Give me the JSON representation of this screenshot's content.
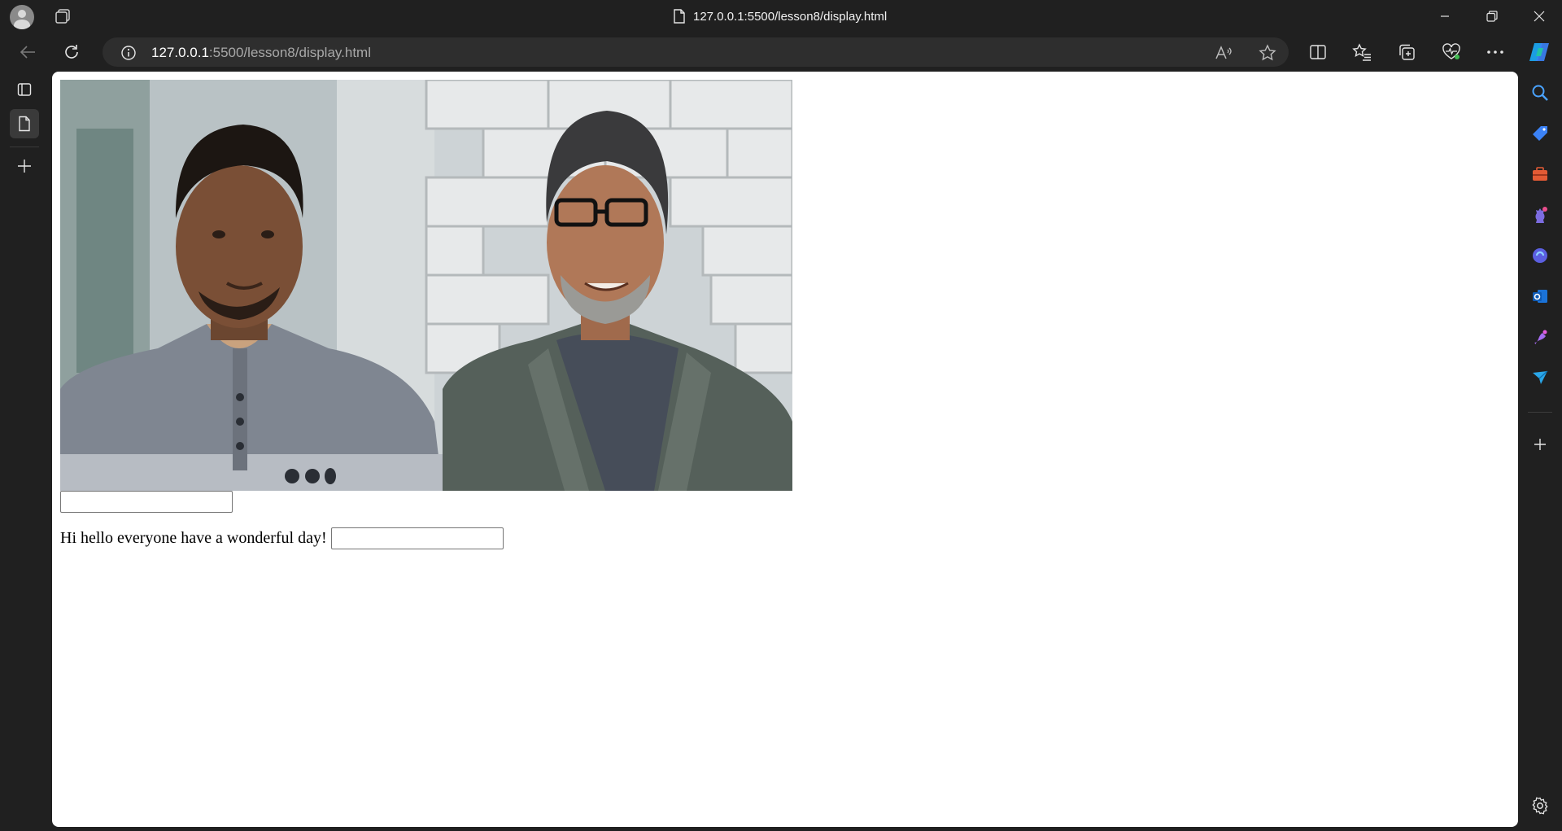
{
  "titlebar": {
    "page_title": "127.0.0.1:5500/lesson8/display.html"
  },
  "address_bar": {
    "url_host": "127.0.0.1",
    "url_rest": ":5500/lesson8/display.html"
  },
  "page": {
    "photo_alt": "Photo of two men smiling",
    "sentence": "Hi hello everyone have a wonderful day!",
    "field1_value": "",
    "field2_value": ""
  },
  "colors": {
    "chrome_bg": "#202020",
    "omnibox_bg": "#2e2e2e",
    "page_bg": "#ffffff"
  },
  "icons": {
    "left": [
      "profile-avatar",
      "workspaces-icon",
      "tab-actions-icon",
      "page-tab-icon",
      "new-tab-plus-icon"
    ],
    "right": [
      "search-icon",
      "shopping-tag-icon",
      "tools-briefcase-icon",
      "games-chess-icon",
      "copilot-icon",
      "outlook-icon",
      "designer-icon",
      "send-icon",
      "add-icon",
      "settings-gear-icon"
    ]
  }
}
